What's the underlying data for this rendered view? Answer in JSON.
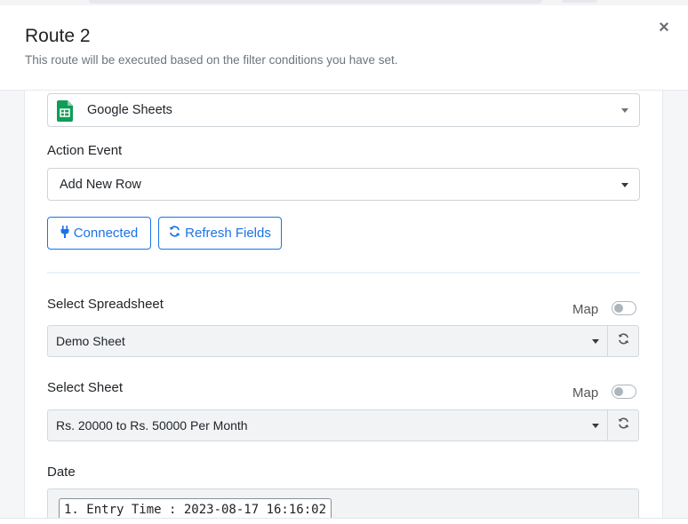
{
  "modal": {
    "title": "Route 2",
    "subtitle": "This route will be executed based on the filter conditions you have set."
  },
  "app_select": {
    "value": "Google Sheets",
    "icon": "google-sheets-icon"
  },
  "action_event": {
    "label": "Action Event",
    "value": "Add New Row"
  },
  "buttons": {
    "connected": "Connected",
    "refresh_fields": "Refresh Fields"
  },
  "spreadsheet": {
    "label": "Select Spreadsheet",
    "map_label": "Map",
    "value": "Demo Sheet"
  },
  "sheet": {
    "label": "Select Sheet",
    "map_label": "Map",
    "value": "Rs. 20000 to Rs. 50000 Per Month"
  },
  "date": {
    "label": "Date",
    "chip": "1. Entry Time : 2023-08-17 16:16:02"
  },
  "colors": {
    "accent": "#1a73e8",
    "sheets_green": "#0f9d58"
  }
}
